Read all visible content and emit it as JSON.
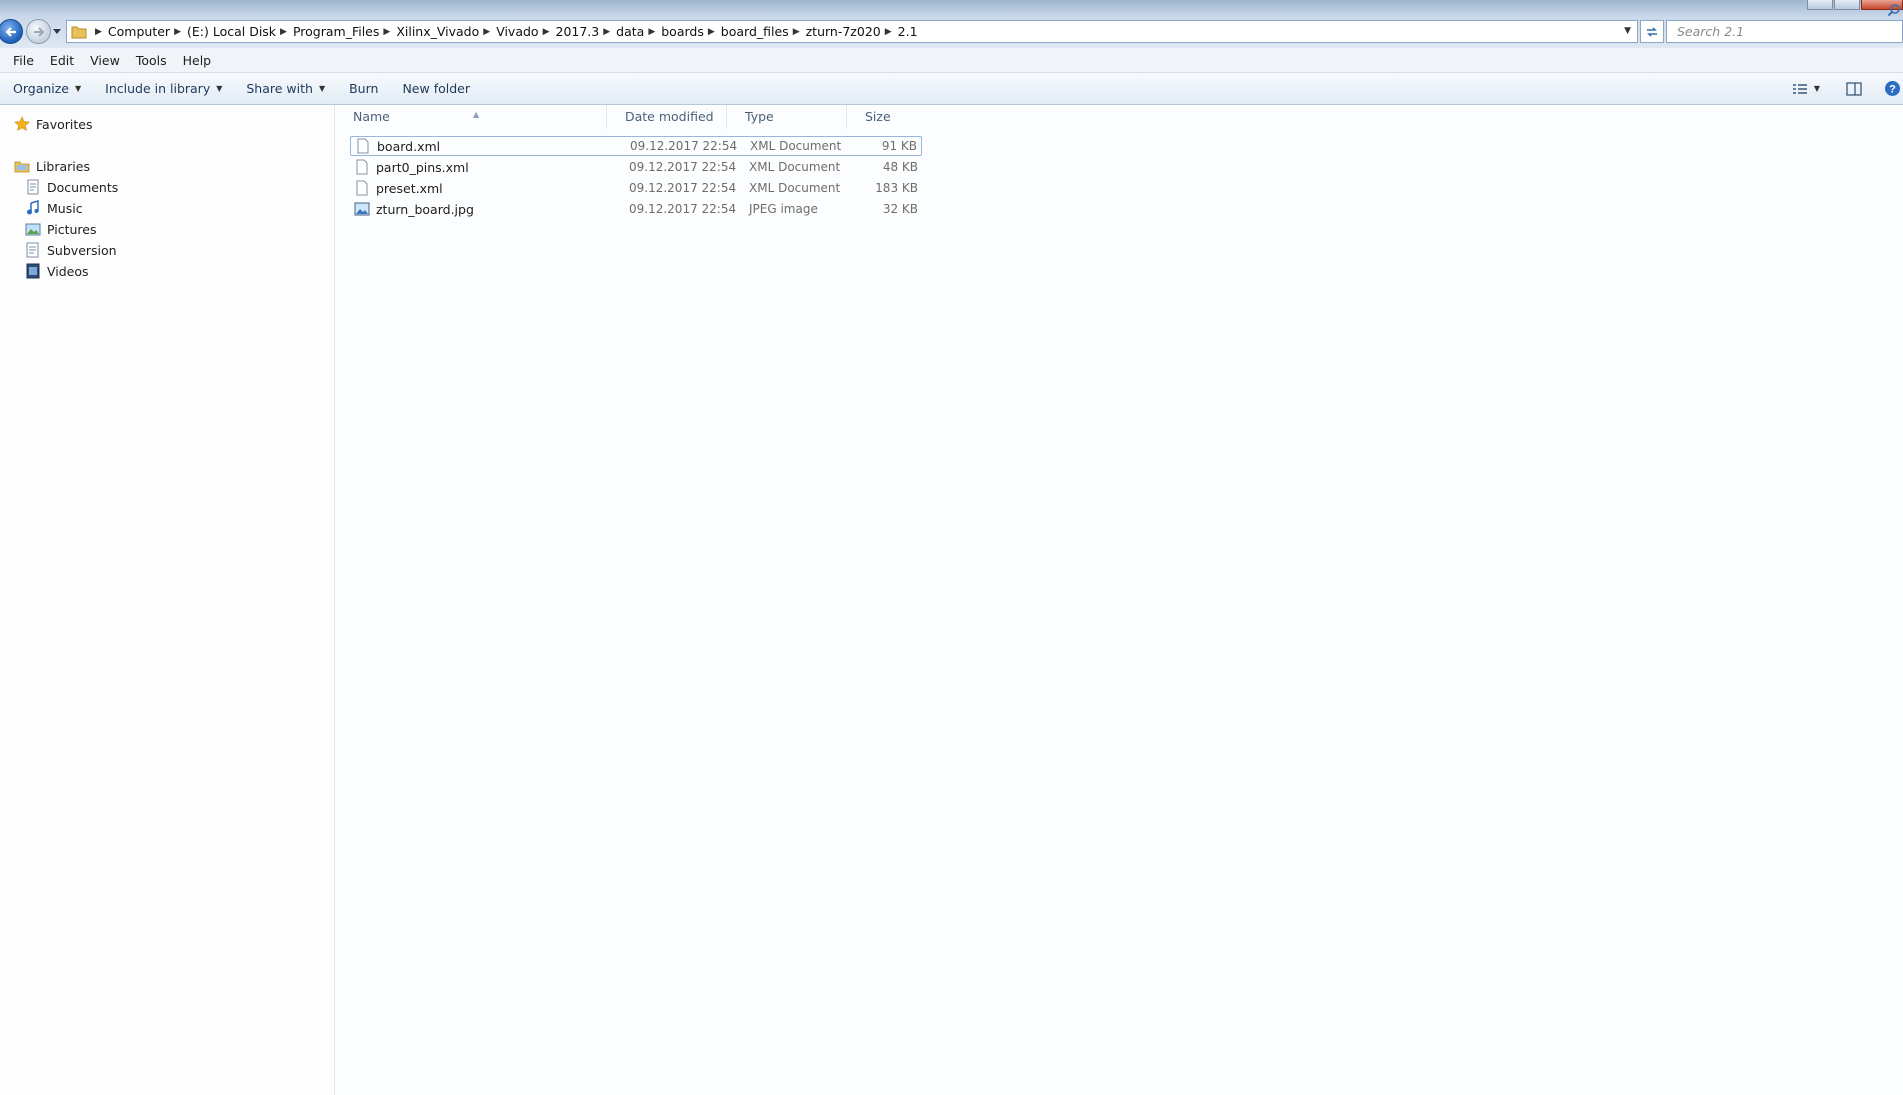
{
  "address_bar": {
    "breadcrumbs": [
      "Computer",
      "(E:) Local Disk",
      "Program_Files",
      "Xilinx_Vivado",
      "Vivado",
      "2017.3",
      "data",
      "boards",
      "board_files",
      "zturn-7z020",
      "2.1"
    ]
  },
  "search": {
    "placeholder": "Search 2.1"
  },
  "menu": {
    "file": "File",
    "edit": "Edit",
    "view": "View",
    "tools": "Tools",
    "help": "Help"
  },
  "commands": {
    "organize": "Organize",
    "include_in_library": "Include in library",
    "share_with": "Share with",
    "burn": "Burn",
    "new_folder": "New folder"
  },
  "nav": {
    "favorites": "Favorites",
    "libraries": "Libraries",
    "library_items": [
      "Documents",
      "Music",
      "Pictures",
      "Subversion",
      "Videos"
    ]
  },
  "columns": {
    "name": "Name",
    "date": "Date modified",
    "type": "Type",
    "size": "Size"
  },
  "files": [
    {
      "name": "board.xml",
      "date": "09.12.2017 22:54",
      "type": "XML Document",
      "size": "91 KB",
      "icon": "document-icon"
    },
    {
      "name": "part0_pins.xml",
      "date": "09.12.2017 22:54",
      "type": "XML Document",
      "size": "48 KB",
      "icon": "document-icon"
    },
    {
      "name": "preset.xml",
      "date": "09.12.2017 22:54",
      "type": "XML Document",
      "size": "183 KB",
      "icon": "document-icon"
    },
    {
      "name": "zturn_board.jpg",
      "date": "09.12.2017 22:54",
      "type": "JPEG image",
      "size": "32 KB",
      "icon": "image-file-icon"
    }
  ],
  "colors": {
    "accent": "#1d5fb8",
    "selection_border": "#99b6d9"
  }
}
